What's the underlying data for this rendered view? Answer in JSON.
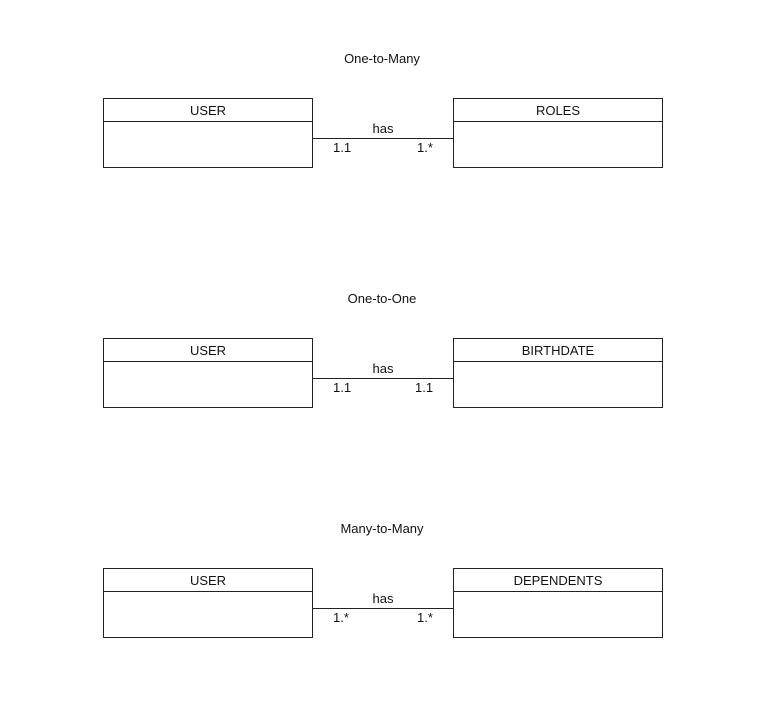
{
  "sections": [
    {
      "title": "One-to-Many",
      "left_entity": "USER",
      "right_entity": "ROLES",
      "relation": "has",
      "left_card": "1.1",
      "right_card": "1.*"
    },
    {
      "title": "One-to-One",
      "left_entity": "USER",
      "right_entity": "BIRTHDATE",
      "relation": "has",
      "left_card": "1.1",
      "right_card": "1.1"
    },
    {
      "title": "Many-to-Many",
      "left_entity": "USER",
      "right_entity": "DEPENDENTS",
      "relation": "has",
      "left_card": "1.*",
      "right_card": "1.*"
    }
  ]
}
